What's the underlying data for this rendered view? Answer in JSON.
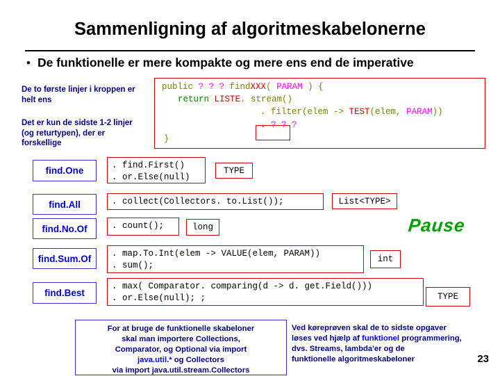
{
  "slide": {
    "title": "Sammenligning af algoritmeskabelonerne",
    "bullet": {
      "marker": "•",
      "text": "De funktionelle er mere kompakte og mere ens end de imperative"
    },
    "notes": [
      "De to første linjer i kroppen er helt ens",
      "Det er kun de sidste 1-2 linjer (og returtypen), der er forskellige"
    ],
    "code": {
      "line1_pre": "public ",
      "line1_q": "? ? ?",
      "line1_mid": " find",
      "line1_xxx": "XXX",
      "line1_paren_open": "( ",
      "line1_param": "PARAM",
      "line1_close": " ) {",
      "line2_ret": "return ",
      "line2_liste": "LISTE",
      "line2_stream": ". stream()",
      "line3_filter": ". filter(elem -> ",
      "line3_test": "TEST",
      "line3_args": "(elem, ",
      "line3_param": "PARAM",
      "line3_end": "))",
      "line4": ". ? ? ?",
      "line5": "}"
    },
    "rows": [
      {
        "name": "find.One",
        "snippet": ". find.First()\n. or.Else(null)",
        "type": "TYPE"
      },
      {
        "name": "find.All",
        "snippet": ". collect(Collectors. to.List());",
        "type": "List<TYPE>"
      },
      {
        "name": "find.No.Of",
        "snippet": ". count();",
        "type": "long"
      },
      {
        "name": "find.Sum.Of",
        "snippet": ". map.To.Int(elem -> VALUE(elem, PARAM))\n. sum();",
        "type": "int"
      },
      {
        "name": "find.Best",
        "snippet": ". max( Comparator. comparing(d -> d. get.Field()))\n. or.Else(null); ;",
        "type": "TYPE"
      }
    ],
    "pause_label": "Pause",
    "bottom_left": {
      "line1": "For at bruge de funktionelle skabeloner",
      "line2": "skal man importere Collections,",
      "line3": "Comparator, og Optional via import",
      "line4_a": "java.util.*",
      "line4_b": " og Collectors",
      "line5": "via import java.util.stream.Collectors"
    },
    "bottom_right": {
      "line1": "Ved køreprøven skal de to sidste opgaver",
      "line2a": "løses ved hjælp af ",
      "line2b": "funktionel",
      "line2c": " programmering,",
      "line3": "dvs. Streams, lambda'er og de",
      "line4": "funktionelle algoritmeskabeloner"
    },
    "page_number": "23",
    "colors": {
      "title": "#000000",
      "note": "#000080",
      "code_olive": "#808000",
      "code_pink": "#ff00ff",
      "code_red": "#cc0000",
      "code_blue": "#0000cc",
      "box_red": "#cc0000",
      "box_blue": "#3333cc",
      "pause_green": "#00a000"
    }
  }
}
